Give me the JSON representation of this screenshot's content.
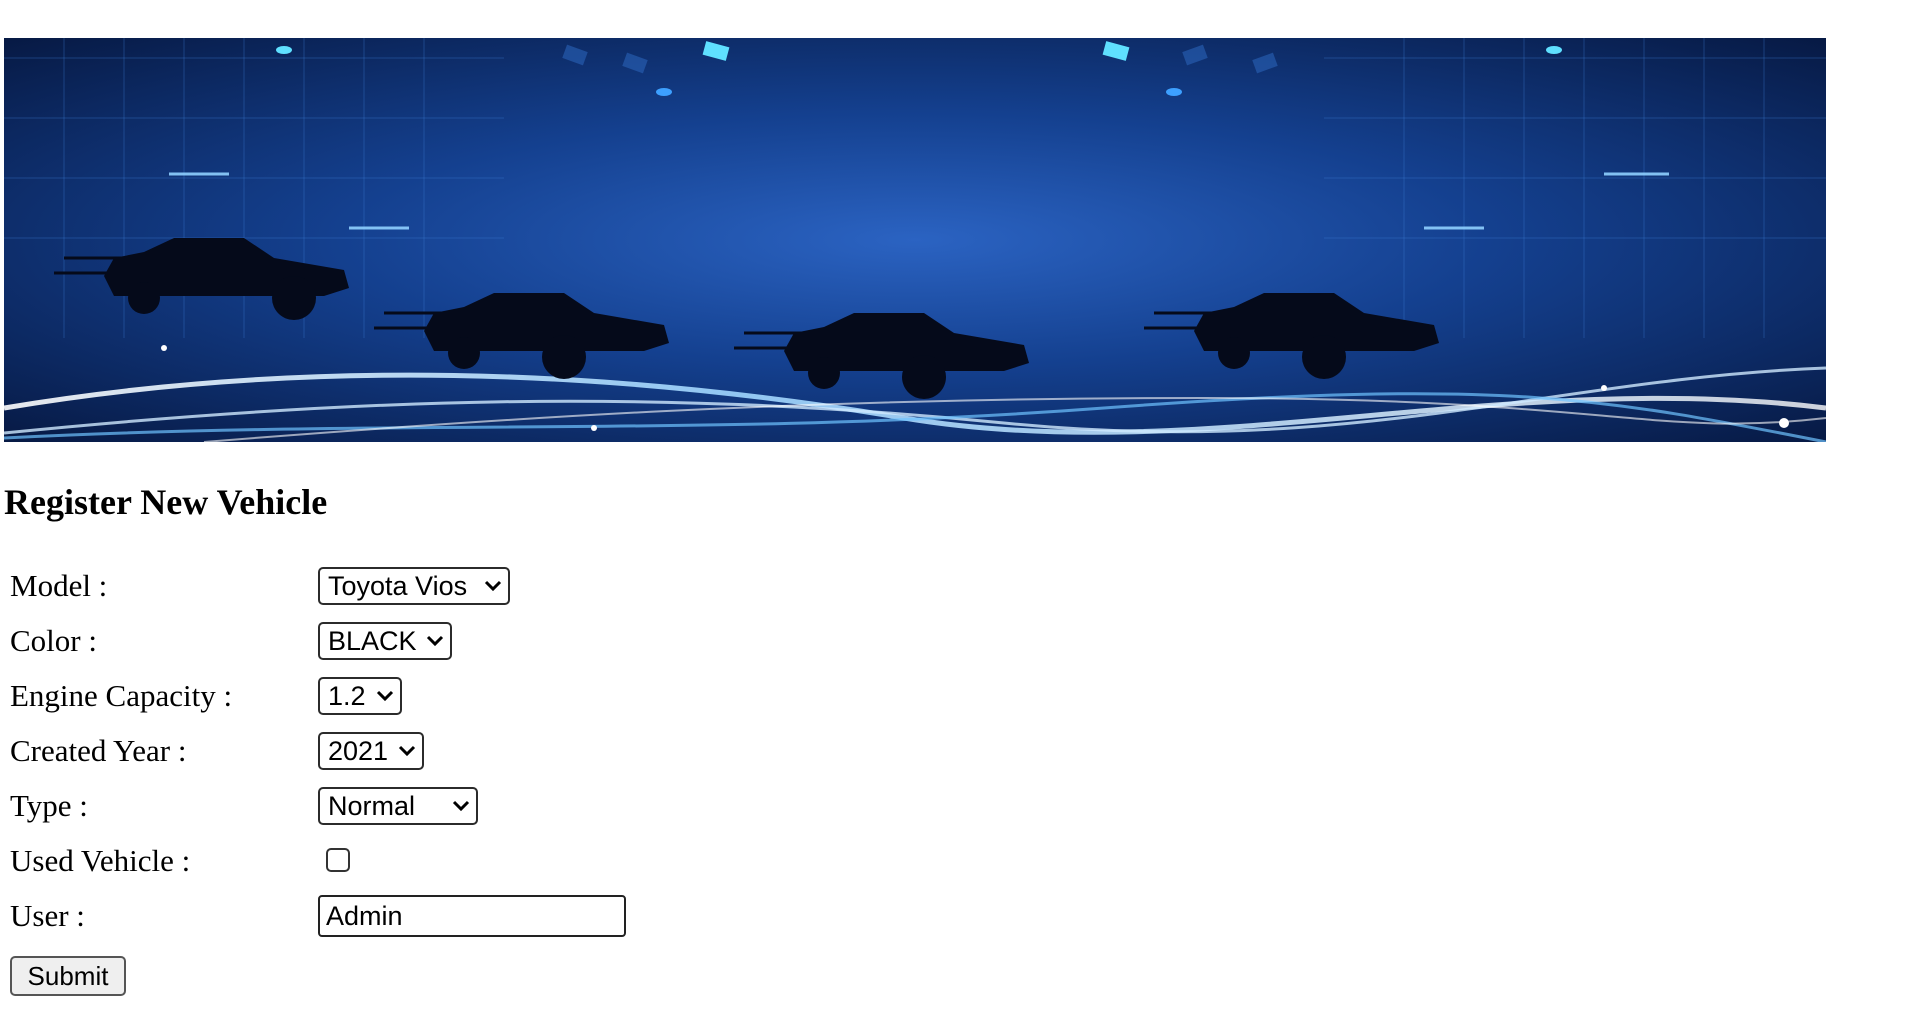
{
  "page": {
    "title": "Register New Vehicle"
  },
  "banner": {
    "description_icon": "speeding-cars-image"
  },
  "form": {
    "model": {
      "label": "Model :",
      "value": "Toyota Vios"
    },
    "color": {
      "label": "Color :",
      "value": "BLACK"
    },
    "engine_capacity": {
      "label": "Engine Capacity :",
      "value": "1.2"
    },
    "created_year": {
      "label": "Created Year :",
      "value": "2021"
    },
    "type": {
      "label": "Type :",
      "value": "Normal"
    },
    "used_vehicle": {
      "label": "Used Vehicle :",
      "checked": false
    },
    "user": {
      "label": "User :",
      "value": "Admin"
    },
    "submit_label": "Submit"
  },
  "colors": {
    "banner_dark": "#0a1f4d",
    "banner_mid": "#1a4fa8",
    "banner_glow": "#6fc3ff"
  }
}
